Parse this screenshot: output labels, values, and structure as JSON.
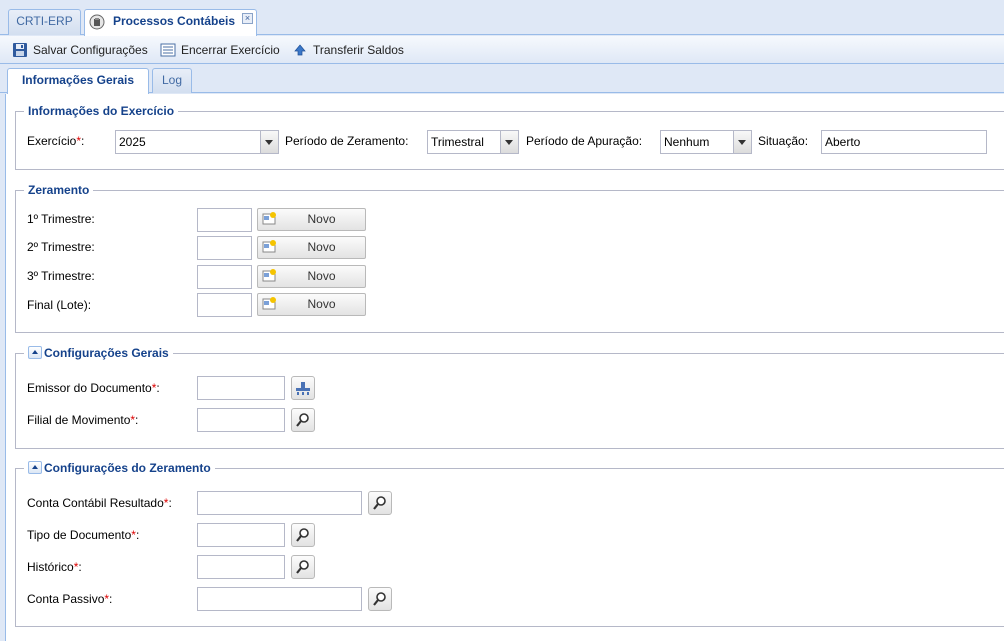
{
  "tabs": {
    "erp": "CRTI-ERP",
    "processos": "Processos Contábeis",
    "close_symbol": "×"
  },
  "toolbar": {
    "save_label": "Salvar Configurações",
    "close_year_label": "Encerrar Exercício",
    "transfer_label": "Transferir Saldos"
  },
  "subtabs": {
    "info": "Informações Gerais",
    "log": "Log"
  },
  "required_marker": "*",
  "exercicio": {
    "title": "Informações do Exercício",
    "exercicio_label": "Exercício",
    "exercicio_value": "2025",
    "zeramento_label": "Período de Zeramento:",
    "zeramento_value": "Trimestral",
    "apuracao_label": "Período de Apuração:",
    "apuracao_value": "Nenhum",
    "situacao_label": "Situação:",
    "situacao_value": "Aberto",
    "colon": ":"
  },
  "zeramento": {
    "title": "Zeramento",
    "rows": [
      {
        "label": "1º Trimestre:",
        "value": "",
        "button": "Novo"
      },
      {
        "label": "2º Trimestre:",
        "value": "",
        "button": "Novo"
      },
      {
        "label": "3º Trimestre:",
        "value": "",
        "button": "Novo"
      },
      {
        "label": "Final (Lote):",
        "value": "",
        "button": "Novo"
      }
    ]
  },
  "config_gerais": {
    "title": "Configurações Gerais",
    "emissor_label": "Emissor do Documento",
    "emissor_value": "",
    "filial_label": "Filial de Movimento",
    "filial_value": ""
  },
  "config_zeramento": {
    "title": "Configurações do Zeramento",
    "conta_resultado_label": "Conta Contábil Resultado",
    "conta_resultado_value": "",
    "tipo_doc_label": "Tipo de Documento",
    "tipo_doc_value": "",
    "historico_label": "Histórico",
    "historico_value": "",
    "conta_passivo_label": "Conta Passivo",
    "conta_passivo_value": ""
  },
  "colors": {
    "accent": "#15428b",
    "border": "#99bbe8",
    "background": "#dfe8f6",
    "required": "#dd0000"
  },
  "icons": {
    "save": "floppy-disk-icon",
    "close_year": "list-icon",
    "transfer": "arrow-up-icon",
    "tab": "process-icon",
    "new": "new-document-icon",
    "lookup": "magnifier-icon",
    "emissor": "building-icon"
  }
}
